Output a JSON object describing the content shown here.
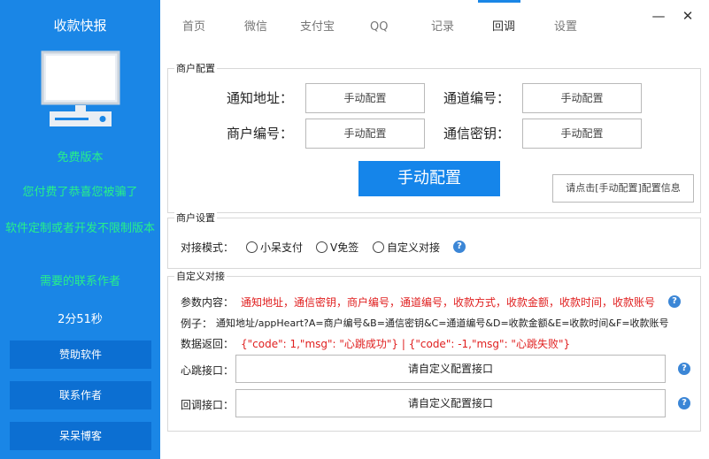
{
  "sidebar": {
    "title": "收款快报",
    "monitor_icon": "monitor-icon",
    "free_version": "免费版本",
    "paid_warning": "您付费了恭喜您被骗了",
    "custom_dev": "软件定制或者开发不限制版本",
    "contact_author": "需要的联系作者",
    "timer": "2分51秒",
    "buttons": [
      "赞助软件",
      "联系作者",
      "呆呆博客"
    ]
  },
  "tabs": [
    {
      "label": "首页",
      "active": false
    },
    {
      "label": "微信",
      "active": false
    },
    {
      "label": "支付宝",
      "active": false
    },
    {
      "label": "QQ",
      "active": false
    },
    {
      "label": "记录",
      "active": false
    },
    {
      "label": "回调",
      "active": true
    },
    {
      "label": "设置",
      "active": false
    }
  ],
  "window": {
    "minimize": "—",
    "close": "✕"
  },
  "merchant_config": {
    "legend": "商户配置",
    "notify_url_label": "通知地址：",
    "notify_url_value": "手动配置",
    "channel_no_label": "通道编号：",
    "channel_no_value": "手动配置",
    "merchant_no_label": "商户编号：",
    "merchant_no_value": "手动配置",
    "secret_label": "通信密钥：",
    "secret_value": "手动配置",
    "manual_button": "手动配置",
    "hint_button": "请点击[手动配置]配置信息"
  },
  "merchant_settings": {
    "legend": "商户设置",
    "mode_label": "对接模式：",
    "options": [
      "小呆支付",
      "V免签",
      "自定义对接"
    ],
    "help": "?"
  },
  "custom": {
    "legend": "自定义对接",
    "params_label": "参数内容：",
    "params_value": "通知地址，通信密钥，商户编号，通道编号，收款方式，收款金额，收款时间，收款账号",
    "example_label": "例子：",
    "example_value": "通知地址/appHeart?A=商户编号&B=通信密钥&C=通道编号&D=收款金额&E=收款时间&F=收款账号",
    "return_label": "数据返回：",
    "return_value": "{\"code\": 1,\"msg\": \"心跳成功\"} | {\"code\": -1,\"msg\": \"心跳失败\"}",
    "heartbeat_label": "心跳接口：",
    "heartbeat_value": "请自定义配置接口",
    "callback_label": "回调接口：",
    "callback_value": "请自定义配置接口",
    "help": "?"
  },
  "colors": {
    "sidebar": "#1a86e6",
    "accent": "#1585ea",
    "green_text": "#27f08a",
    "red_text": "#e02020"
  }
}
